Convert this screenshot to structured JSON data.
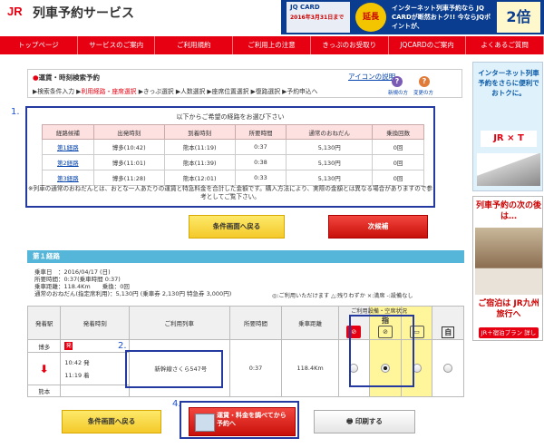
{
  "header": {
    "logo": "JR",
    "site_title": "列車予約サービス",
    "banner": {
      "card": "JQ CARD",
      "extension": "延長",
      "period": "2016年3月31日まで",
      "message": "インターネット列車予約なら JQ CARDが断然おトク!! 今ならJQポイントが、",
      "multiplier": "2倍"
    }
  },
  "nav": [
    "トップページ",
    "サービスのご案内",
    "ご利用規約",
    "ご利用上の注意",
    "きっぷのお受取り",
    "JQCARDのご案内",
    "よくあるご質問"
  ],
  "steps": {
    "title": "運賃・時刻検索予約",
    "icon_help": "アイコンの説明",
    "items": [
      "検索条件入力",
      "利用経路・座席選択",
      "きっぷ選択",
      "人数選択",
      "座席位置選択",
      "復路選択",
      "予約申込へ"
    ],
    "current_index": 1,
    "help_labels": [
      "新規の方",
      "変更の方"
    ]
  },
  "markers": [
    "1.",
    "2.",
    "3.",
    "4."
  ],
  "routes": {
    "instruction": "以下からご希望の経路をお選び下さい",
    "headers": [
      "経路候補",
      "出発時刻",
      "到着時刻",
      "所要時間",
      "通常のおねだん",
      "乗換回数"
    ],
    "rows": [
      [
        "第1経路",
        "博多(10:42)",
        "熊本(11:19)",
        "0:37",
        "5,130円",
        "0回"
      ],
      [
        "第2経路",
        "博多(11:01)",
        "熊本(11:39)",
        "0:38",
        "5,130円",
        "0回"
      ],
      [
        "第3経路",
        "博多(11:28)",
        "熊本(12:01)",
        "0:33",
        "5,130円",
        "0回"
      ]
    ],
    "note": "※列車の通常のおねだんとは、おとな一人あたりの運賃と特急料金を合計した金額です。購入方法により、実際の金額とは異なる場合がありますので参考としてご覧下さい。"
  },
  "buttons": {
    "back": "条件画面へ戻る",
    "next": "次候補",
    "fare": "運賃・料金を調べてから予約へ",
    "print": "印刷する"
  },
  "detail": {
    "section_title": "第１経路",
    "info_lines": [
      "乗車日　：2016/04/17 (日)",
      "所要時間：0:37(乗車時間 0:37)",
      "乗車距離：118.4Km　　乗換：0回",
      "通常のおねだん(指定席利用)：5,130円 (乗車券 2,130円 特急券 3,000円)"
    ],
    "legend": "◎:ご利用いただけます △:残りわずか ×:満席 -:設備なし",
    "seat_group_label": "ご利用設備・空席状況",
    "headers": [
      "発着駅",
      "発着時刻",
      "ご利用列車",
      "所要時間",
      "乗車距離"
    ],
    "seat_heads": [
      "指",
      "自"
    ],
    "from": "博多",
    "to": "熊本",
    "dep": "10:42 発",
    "arr": "11:19 着",
    "train": "新幹線さくら547号",
    "duration": "0:37",
    "distance": "118.4Km"
  },
  "ads": {
    "ad1_text": "インターネット列車予約をさらに便利でおトクに。",
    "ad1_logos": "JR × T",
    "ad2_title": "列車予約の次の後は…",
    "ad2_sub": "ご宿泊は JR九州旅行へ",
    "ad2_button": "JR＋宿泊プラン 詳しくはこちら"
  },
  "colors": {
    "brand_red": "#e60012",
    "highlight_blue": "#243aa0",
    "section_blue": "#56b6d9"
  }
}
